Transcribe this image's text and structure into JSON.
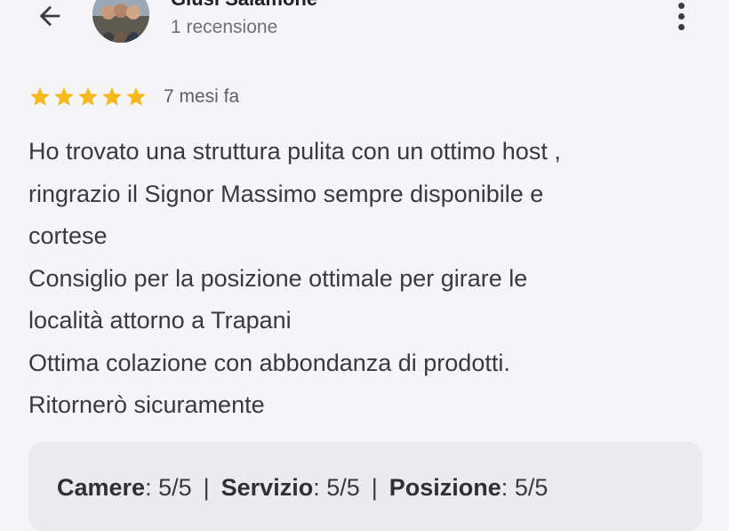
{
  "header": {
    "reviewer_name": "Giusi Salamone",
    "review_count": "1 recensione",
    "back_icon": "arrow-left-icon",
    "more_icon": "more-vert-icon"
  },
  "review": {
    "rating": 5,
    "rating_max": 5,
    "star_color": "#f5b91e",
    "date": "7 mesi fa",
    "lines": [
      "Ho trovato una struttura pulita con un ottimo host ,",
      "ringrazio il Signor Massimo sempre disponibile e",
      "cortese",
      "Consiglio per la posizione ottimale per girare le",
      "località attorno a Trapani",
      "Ottima colazione con abbondanza di prodotti.",
      "Ritornerò sicuramente"
    ]
  },
  "ratings": [
    {
      "label": "Camere",
      "value": "5/5"
    },
    {
      "label": "Servizio",
      "value": "5/5"
    },
    {
      "label": "Posizione",
      "value": "5/5"
    }
  ],
  "separator": "|"
}
